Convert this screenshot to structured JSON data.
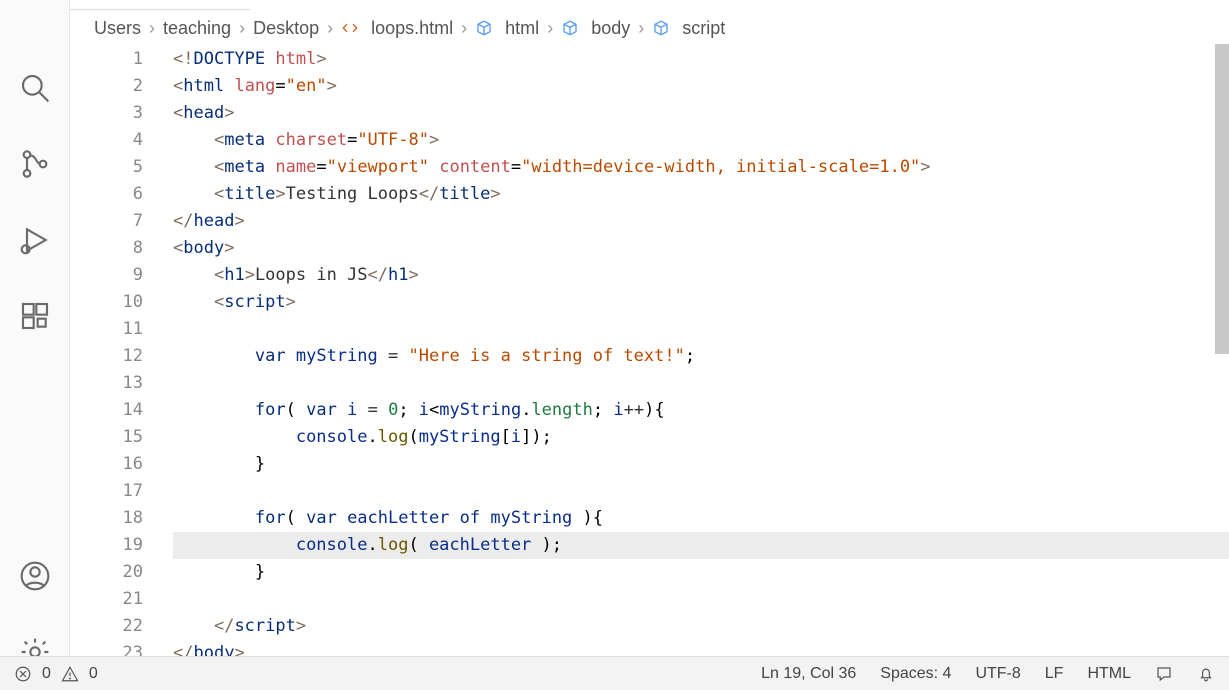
{
  "breadcrumbs": {
    "items": [
      "Users",
      "teaching",
      "Desktop",
      "loops.html",
      "html",
      "body",
      "script"
    ]
  },
  "code": {
    "lines": [
      {
        "n": 1,
        "html": "<span class='t-br'>&lt;!</span><span class='t-tag'>DOCTYPE</span> <span class='t-attr'>html</span><span class='t-br'>&gt;</span>"
      },
      {
        "n": 2,
        "html": "<span class='t-br'>&lt;</span><span class='t-tag'>html</span> <span class='t-attr'>lang</span>=<span class='t-str'>\"en\"</span><span class='t-br'>&gt;</span>"
      },
      {
        "n": 3,
        "html": "<span class='t-br'>&lt;</span><span class='t-tag'>head</span><span class='t-br'>&gt;</span>"
      },
      {
        "n": 4,
        "html": "    <span class='t-br'>&lt;</span><span class='t-tag'>meta</span> <span class='t-attr'>charset</span>=<span class='t-str'>\"UTF-8\"</span><span class='t-br'>&gt;</span>"
      },
      {
        "n": 5,
        "html": "    <span class='t-br'>&lt;</span><span class='t-tag'>meta</span> <span class='t-attr'>name</span>=<span class='t-str'>\"viewport\"</span> <span class='t-attr'>content</span>=<span class='t-str'>\"width=device-width, initial-scale=1.0\"</span><span class='t-br'>&gt;</span>"
      },
      {
        "n": 6,
        "html": "    <span class='t-br'>&lt;</span><span class='t-tag'>title</span><span class='t-br'>&gt;</span><span class='t-text'>Testing Loops</span><span class='t-br'>&lt;/</span><span class='t-tag'>title</span><span class='t-br'>&gt;</span>"
      },
      {
        "n": 7,
        "html": "<span class='t-br'>&lt;/</span><span class='t-tag'>head</span><span class='t-br'>&gt;</span>"
      },
      {
        "n": 8,
        "html": "<span class='t-br'>&lt;</span><span class='t-tag'>body</span><span class='t-br'>&gt;</span>"
      },
      {
        "n": 9,
        "html": "    <span class='t-br'>&lt;</span><span class='t-tag'>h1</span><span class='t-br'>&gt;</span><span class='t-text'>Loops in JS</span><span class='t-br'>&lt;/</span><span class='t-tag'>h1</span><span class='t-br'>&gt;</span>"
      },
      {
        "n": 10,
        "html": "    <span class='t-br'>&lt;</span><span class='t-tag'>script</span><span class='t-br'>&gt;</span>"
      },
      {
        "n": 11,
        "html": ""
      },
      {
        "n": 12,
        "html": "        <span class='t-kw'>var</span> <span class='t-var'>myString</span> <span class='t-op'>=</span> <span class='t-str'>\"Here is a string of text!\"</span>;"
      },
      {
        "n": 13,
        "html": ""
      },
      {
        "n": 14,
        "html": "        <span class='t-kw'>for</span>( <span class='t-kw'>var</span> <span class='t-var'>i</span> <span class='t-op'>=</span> <span class='t-num'>0</span>; <span class='t-var'>i</span>&lt;<span class='t-var'>myString</span>.<span class='t-id'>length</span>; <span class='t-var'>i</span><span class='t-op'>++</span>){"
      },
      {
        "n": 15,
        "html": "            <span class='t-var'>console</span>.<span class='t-fn'>log</span>(<span class='t-var'>myString</span>[<span class='t-var'>i</span>]);"
      },
      {
        "n": 16,
        "html": "        }"
      },
      {
        "n": 17,
        "html": ""
      },
      {
        "n": 18,
        "html": "        <span class='t-kw'>for</span>( <span class='t-kw'>var</span> <span class='t-var'>eachLetter</span> <span class='t-kw'>of</span> <span class='t-var'>myString</span> ){"
      },
      {
        "n": 19,
        "hl": true,
        "html": "            <span class='t-var'>console</span>.<span class='t-fn'>log</span>( <span class='t-var'>eachLetter</span> );"
      },
      {
        "n": 20,
        "html": "        }"
      },
      {
        "n": 21,
        "html": ""
      },
      {
        "n": 22,
        "html": "    <span class='t-br'>&lt;/</span><span class='t-tag'>script</span><span class='t-br'>&gt;</span>"
      },
      {
        "n": 23,
        "html": "<span class='t-br'>&lt;/</span><span class='t-tag'>body</span><span class='t-br'>&gt;</span>"
      }
    ]
  },
  "status": {
    "errors": "0",
    "warnings": "0",
    "position": "Ln 19, Col 36",
    "spaces": "Spaces: 4",
    "encoding": "UTF-8",
    "eol": "LF",
    "language": "HTML"
  }
}
